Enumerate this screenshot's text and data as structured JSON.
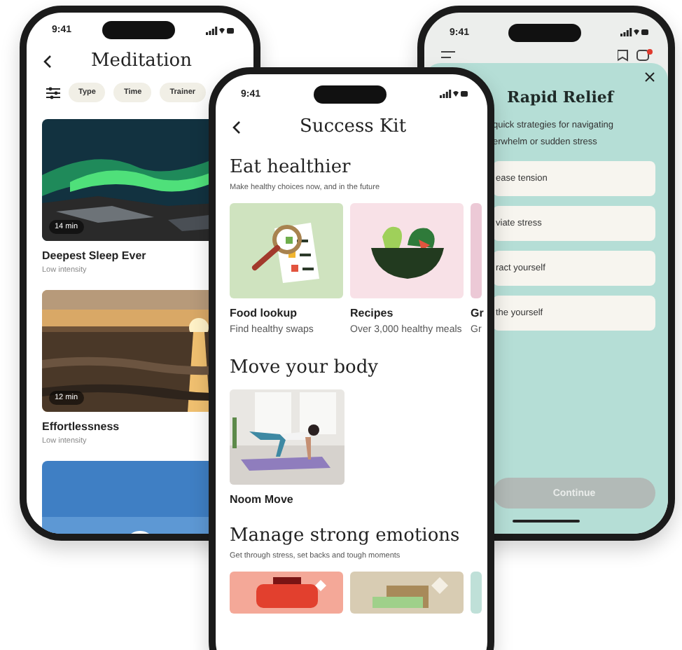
{
  "meditation_screen": {
    "status_time": "9:41",
    "title": "Meditation",
    "filters": [
      {
        "label": "Type"
      },
      {
        "label": "Time"
      },
      {
        "label": "Trainer"
      }
    ],
    "sessions": [
      {
        "kind": "aurora",
        "duration": "14 min",
        "title": "Deepest Sleep Ever",
        "subtitle": "Low intensity"
      },
      {
        "kind": "sunset",
        "duration": "12 min",
        "title": "Effortlessness",
        "subtitle": "Low intensity"
      },
      {
        "kind": "sky"
      }
    ]
  },
  "success_kit_screen": {
    "status_time": "9:41",
    "title": "Success Kit",
    "sections": [
      {
        "heading": "Eat healthier",
        "subheading": "Make healthy choices now, and in the future",
        "cards": [
          {
            "kind": "lookup",
            "color": "#cfe3bf",
            "title": "Food lookup",
            "subtitle": "Find healthy swaps"
          },
          {
            "kind": "salad",
            "color": "#f8e1e7",
            "title": "Recipes",
            "subtitle": "Over 3,000 healthy meals"
          },
          {
            "kind": "plain",
            "color": "#ecc9d6",
            "title": "Gr",
            "subtitle": "Gr"
          }
        ]
      },
      {
        "heading": "Move your body",
        "cards": [
          {
            "title": "Noom Move"
          }
        ]
      },
      {
        "heading": "Manage strong emotions",
        "subheading": "Get through stress, set backs and tough moments",
        "cards": [
          {
            "kind": "bag",
            "color": "#f4a898"
          },
          {
            "kind": "blocks",
            "color": "#d8ccb3"
          },
          {
            "kind": "plain",
            "color": "#bfe0d8"
          }
        ]
      }
    ]
  },
  "rapid_relief_screen": {
    "status_time": "9:41",
    "title": "Rapid Relief",
    "description_lines": [
      "quick strategies for navigating",
      "erwhelm or sudden stress"
    ],
    "options": [
      "ease tension",
      "viate stress",
      "ract yourself",
      "the yourself"
    ],
    "continue": {
      "label": "Continue",
      "disabled": true
    }
  }
}
